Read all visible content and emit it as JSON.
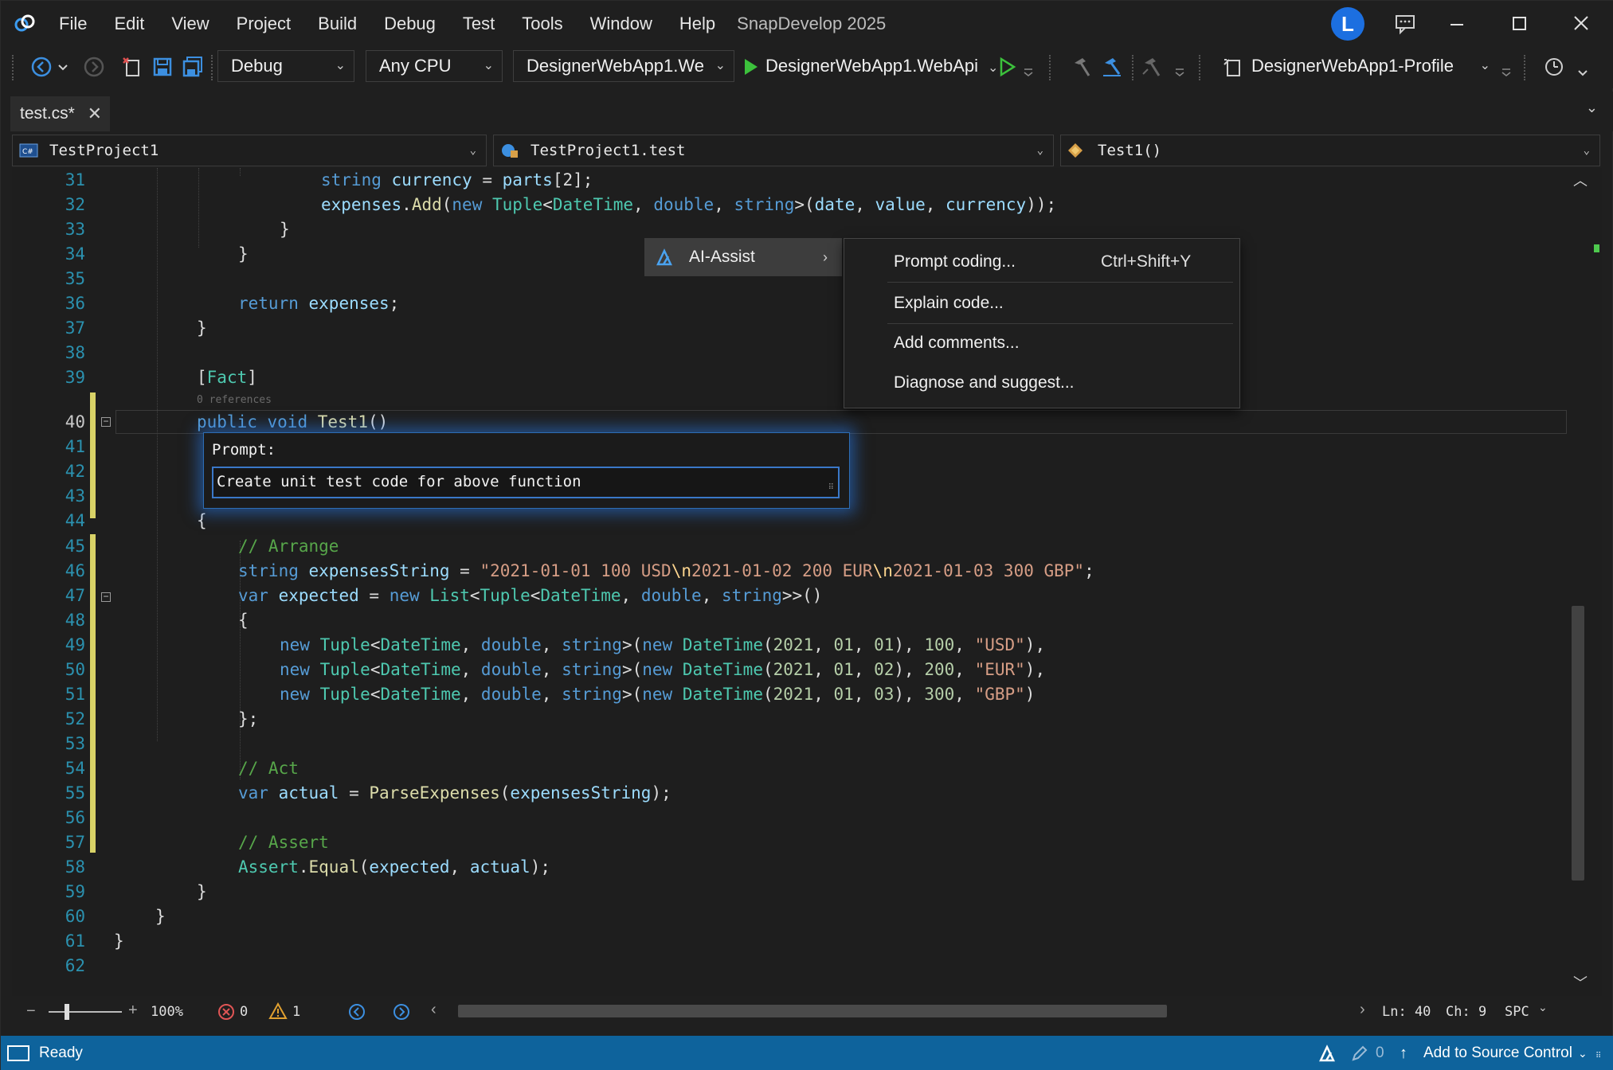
{
  "titlebar": {
    "menu": [
      "File",
      "Edit",
      "View",
      "Project",
      "Build",
      "Debug",
      "Test",
      "Tools",
      "Window",
      "Help"
    ],
    "app_title": "SnapDevelop 2025",
    "avatar_letter": "L"
  },
  "toolbar": {
    "config": "Debug",
    "platform": "Any CPU",
    "startup_project": "DesignerWebApp1.We",
    "run_target": "DesignerWebApp1.WebApi",
    "profile": "DesignerWebApp1-Profile"
  },
  "tabs": [
    {
      "label": "test.cs*"
    }
  ],
  "navbar": {
    "project": "TestProject1",
    "type": "TestProject1.test",
    "member": "Test1()"
  },
  "editor": {
    "line_numbers": [
      "31",
      "32",
      "33",
      "34",
      "35",
      "36",
      "37",
      "38",
      "39",
      "40",
      "41",
      "42",
      "43",
      "44",
      "45",
      "46",
      "47",
      "48",
      "49",
      "50",
      "51",
      "52",
      "53",
      "54",
      "55",
      "56",
      "57",
      "58",
      "59",
      "60",
      "61",
      "62"
    ],
    "codelens": "0 references"
  },
  "context_menu": {
    "item": "AI-Assist",
    "submenu": [
      {
        "label": "Prompt coding...",
        "shortcut": "Ctrl+Shift+Y"
      },
      {
        "label": "Explain code...",
        "shortcut": ""
      },
      {
        "label": "Add comments...",
        "shortcut": ""
      },
      {
        "label": "Diagnose and suggest...",
        "shortcut": ""
      }
    ]
  },
  "prompt": {
    "label": "Prompt:",
    "value": "Create unit test code for above function"
  },
  "editor_status": {
    "zoom": "100%",
    "errors": "0",
    "warnings": "1",
    "line": "Ln: 40",
    "col": "Ch: 9",
    "encoding": "SPC"
  },
  "statusbar": {
    "state": "Ready",
    "pending_count": "0",
    "source_control": "Add to Source Control"
  },
  "colors": {
    "accent": "#0e639c",
    "keyword": "#569cd6",
    "type": "#4ec9b0",
    "string": "#d69d85",
    "comment": "#57a64a",
    "change_marker": "#d8d267"
  }
}
